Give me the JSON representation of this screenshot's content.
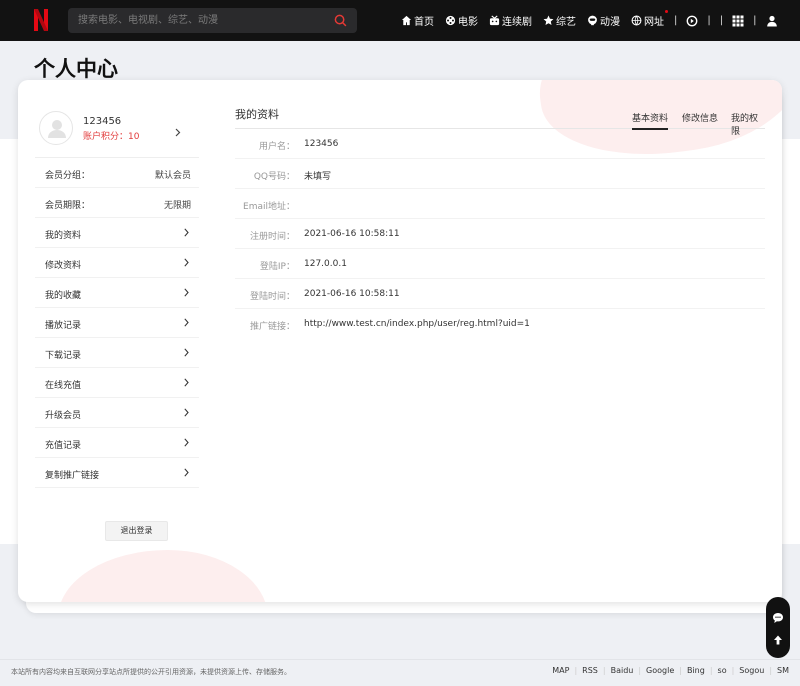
{
  "header": {
    "search_placeholder": "搜索电影、电视剧、综艺、动漫",
    "nav": [
      {
        "label": "首页",
        "icon": "home-icon"
      },
      {
        "label": "电影",
        "icon": "film-reel-icon"
      },
      {
        "label": "连续剧",
        "icon": "tv-icon"
      },
      {
        "label": "综艺",
        "icon": "star-icon"
      },
      {
        "label": "动漫",
        "icon": "anime-icon"
      },
      {
        "label": "网址",
        "icon": "globe-icon"
      }
    ],
    "separator": "|",
    "colors": {
      "bar": "#121212",
      "brand": "#e50914"
    }
  },
  "page": {
    "title": "个人中心"
  },
  "sidebar": {
    "username": "123456",
    "points": "账户积分：10",
    "member_group_label": "会员分组：",
    "member_group_value": "默认会员",
    "member_expiry_label": "会员期限：",
    "member_expiry_value": "无限期",
    "items": [
      {
        "label": "我的资料"
      },
      {
        "label": "修改资料"
      },
      {
        "label": "我的收藏"
      },
      {
        "label": "播放记录"
      },
      {
        "label": "下载记录"
      },
      {
        "label": "在线充值"
      },
      {
        "label": "升级会员"
      },
      {
        "label": "充值记录"
      },
      {
        "label": "复制推广链接"
      }
    ],
    "logout": "退出登录"
  },
  "main": {
    "title": "我的资料",
    "tabs": [
      {
        "label": "基本资料",
        "active": true
      },
      {
        "label": "修改信息",
        "active": false
      },
      {
        "label": "我的权限",
        "active": false
      }
    ],
    "rows": [
      {
        "key": "用户名：",
        "value": "123456"
      },
      {
        "key": "QQ号码：",
        "value": "未填写"
      },
      {
        "key": "Email地址：",
        "value": ""
      },
      {
        "key": "注册时间：",
        "value": "2021-06-16 10:58:11"
      },
      {
        "key": "登陆IP：",
        "value": "127.0.0.1"
      },
      {
        "key": "登陆时间：",
        "value": "2021-06-16 10:58:11"
      },
      {
        "key": "推广链接：",
        "value": "http://www.test.cn/index.php/user/reg.html?uid=1"
      }
    ]
  },
  "footer": {
    "note": "本站所有内容均来自互联网分享站点所提供的公开引用资源，未提供资源上传、存储服务。",
    "links": [
      "MAP",
      "RSS",
      "Baidu",
      "Google",
      "Bing",
      "so",
      "Sogou",
      "SM"
    ]
  }
}
